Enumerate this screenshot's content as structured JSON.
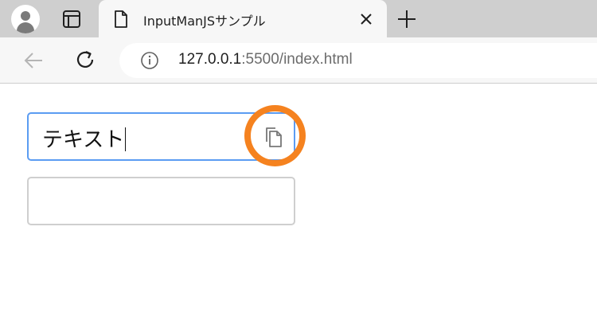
{
  "browser": {
    "tab": {
      "title": "InputManJSサンプル"
    },
    "address_bar": {
      "host": "127.0.0.1",
      "path": ":5500/index.html"
    }
  },
  "page": {
    "inputs": [
      {
        "value": "テキスト",
        "focused": true
      },
      {
        "value": "",
        "focused": false
      }
    ]
  },
  "colors": {
    "focus_border": "#5b9cf2",
    "highlight_ring": "#f5821f",
    "tabstrip": "#cfcfcf"
  }
}
